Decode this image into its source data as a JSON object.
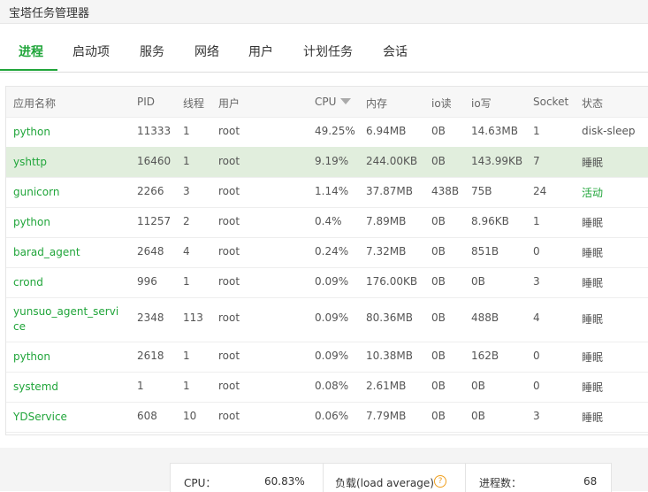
{
  "window": {
    "title": "宝塔任务管理器"
  },
  "tabs": [
    {
      "label": "进程"
    },
    {
      "label": "启动项"
    },
    {
      "label": "服务"
    },
    {
      "label": "网络"
    },
    {
      "label": "用户"
    },
    {
      "label": "计划任务"
    },
    {
      "label": "会话"
    }
  ],
  "table": {
    "headers": {
      "name": "应用名称",
      "pid": "PID",
      "threads": "线程",
      "user": "用户",
      "cpu": "CPU",
      "mem": "内存",
      "io_read": "io读",
      "io_write": "io写",
      "socket": "Socket",
      "status": "状态"
    },
    "rows": [
      {
        "name": "python",
        "pid": "11333",
        "threads": "1",
        "user": "root",
        "cpu": "49.25%",
        "mem": "6.94MB",
        "io_read": "0B",
        "io_write": "14.63MB",
        "socket": "1",
        "status": "disk-sleep"
      },
      {
        "name": "yshttp",
        "pid": "16460",
        "threads": "1",
        "user": "root",
        "cpu": "9.19%",
        "mem": "244.00KB",
        "io_read": "0B",
        "io_write": "143.99KB",
        "socket": "7",
        "status": "睡眠"
      },
      {
        "name": "gunicorn",
        "pid": "2266",
        "threads": "3",
        "user": "root",
        "cpu": "1.14%",
        "mem": "37.87MB",
        "io_read": "438B",
        "io_write": "75B",
        "socket": "24",
        "status": "活动"
      },
      {
        "name": "python",
        "pid": "11257",
        "threads": "2",
        "user": "root",
        "cpu": "0.4%",
        "mem": "7.89MB",
        "io_read": "0B",
        "io_write": "8.96KB",
        "socket": "1",
        "status": "睡眠"
      },
      {
        "name": "barad_agent",
        "pid": "2648",
        "threads": "4",
        "user": "root",
        "cpu": "0.24%",
        "mem": "7.32MB",
        "io_read": "0B",
        "io_write": "851B",
        "socket": "0",
        "status": "睡眠"
      },
      {
        "name": "crond",
        "pid": "996",
        "threads": "1",
        "user": "root",
        "cpu": "0.09%",
        "mem": "176.00KB",
        "io_read": "0B",
        "io_write": "0B",
        "socket": "3",
        "status": "睡眠"
      },
      {
        "name": "yunsuo_agent_service",
        "pid": "2348",
        "threads": "113",
        "user": "root",
        "cpu": "0.09%",
        "mem": "80.36MB",
        "io_read": "0B",
        "io_write": "488B",
        "socket": "4",
        "status": "睡眠"
      },
      {
        "name": "python",
        "pid": "2618",
        "threads": "1",
        "user": "root",
        "cpu": "0.09%",
        "mem": "10.38MB",
        "io_read": "0B",
        "io_write": "162B",
        "socket": "0",
        "status": "睡眠"
      },
      {
        "name": "systemd",
        "pid": "1",
        "threads": "1",
        "user": "root",
        "cpu": "0.08%",
        "mem": "2.61MB",
        "io_read": "0B",
        "io_write": "0B",
        "socket": "0",
        "status": "睡眠"
      },
      {
        "name": "YDService",
        "pid": "608",
        "threads": "10",
        "user": "root",
        "cpu": "0.06%",
        "mem": "7.79MB",
        "io_read": "0B",
        "io_write": "0B",
        "socket": "3",
        "status": "睡眠"
      }
    ]
  },
  "footer": {
    "cpu_label": "CPU：",
    "cpu_value": "60.83%",
    "load_label": "负载(load average)",
    "help_glyph": "?",
    "proc_label": "进程数：",
    "proc_value": "68"
  },
  "colors": {
    "accent": "#20a53a",
    "selected_row": "#e1eedd",
    "help": "#f0a020"
  }
}
